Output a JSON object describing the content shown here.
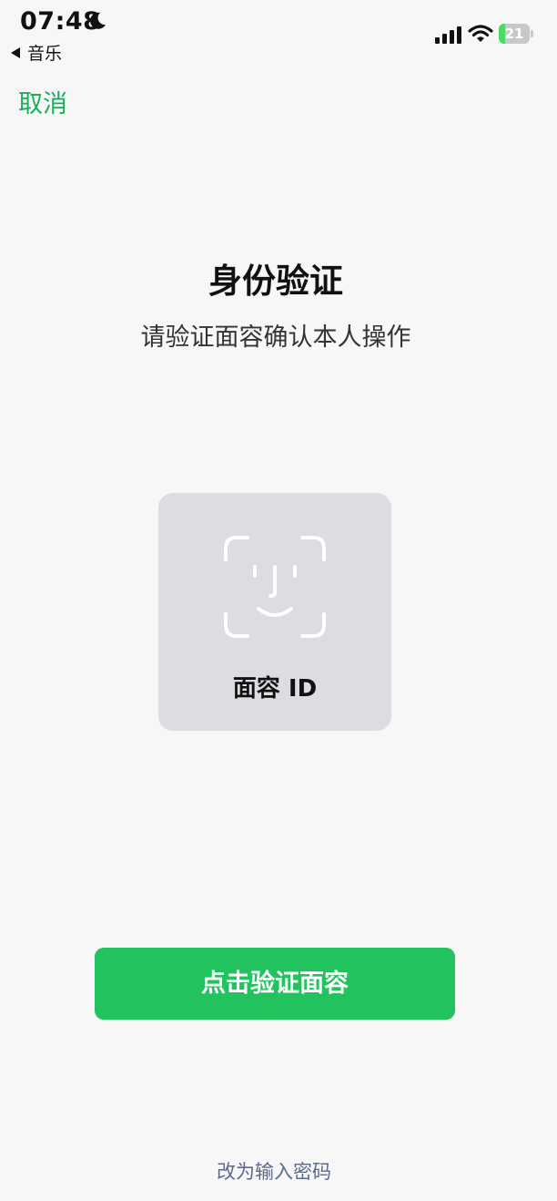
{
  "status_bar": {
    "time": "07:48",
    "back_app": "音乐",
    "battery_level": "21",
    "battery_fraction": 0.21,
    "icons": [
      "moon-icon",
      "signal-icon",
      "wifi-icon",
      "battery-icon"
    ]
  },
  "nav": {
    "cancel_label": "取消"
  },
  "header": {
    "title": "身份验证",
    "subtitle": "请验证面容确认本人操作"
  },
  "face_card": {
    "icon": "face-id-icon",
    "label": "面容 ID"
  },
  "actions": {
    "verify_label": "点击验证面容",
    "password_link": "改为输入密码"
  },
  "colors": {
    "accent": "#1aad5b",
    "button": "#22c35e",
    "link": "#5b6b8c",
    "card": "#dcdde0",
    "background": "#f7f7f7"
  }
}
